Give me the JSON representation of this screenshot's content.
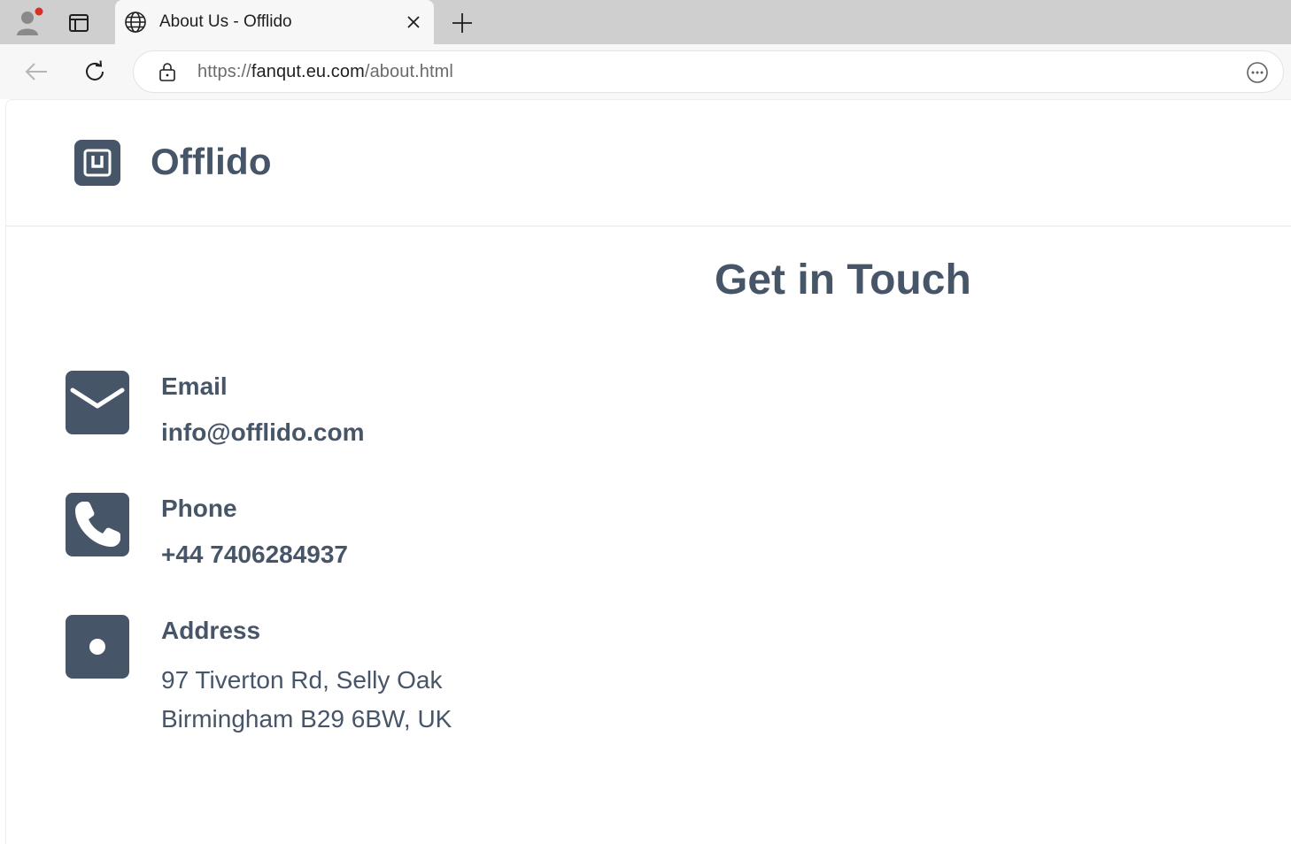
{
  "browser": {
    "tab": {
      "title": "About Us - Offlido"
    },
    "address_bar": {
      "url_scheme": "https://",
      "url_host": "fanqut.eu.com",
      "url_path": "/about.html"
    },
    "icons": {
      "profile": "profile-avatar-icon",
      "tab_actions": "tab-actions-icon",
      "favicon": "globe-icon",
      "close": "close-icon",
      "new_tab": "plus-icon",
      "back": "back-arrow-icon",
      "reload": "reload-icon",
      "lock": "lock-icon",
      "more": "more-options-icon"
    }
  },
  "site": {
    "brand": "Offlido",
    "brand_color": "#475569"
  },
  "contact": {
    "title": "Get in Touch",
    "items": [
      {
        "label": "Email",
        "lines": [
          "info@offlido.com"
        ],
        "icon": "mail-icon"
      },
      {
        "label": "Phone",
        "lines": [
          "+44 7406284937"
        ],
        "icon": "phone-icon"
      },
      {
        "label": "Address",
        "lines": [
          "97 Tiverton Rd, Selly Oak",
          "Birmingham B29 6BW, UK"
        ],
        "icon": "location-icon"
      }
    ]
  }
}
